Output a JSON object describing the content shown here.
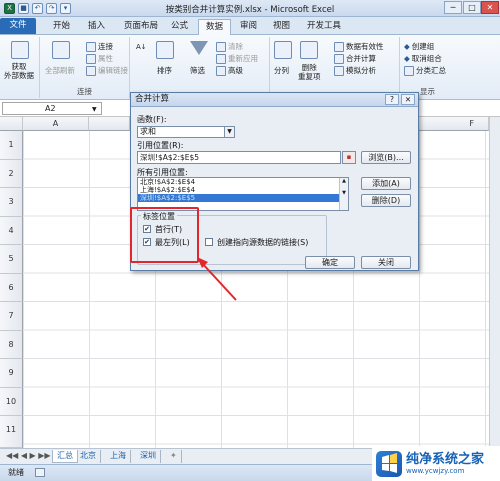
{
  "window": {
    "title": "按类别合并计算实例.xlsx - Microsoft Excel",
    "minimize": "─",
    "maximize": "□",
    "close": "✕"
  },
  "qat": [
    "X",
    "💾",
    "↶",
    "↷",
    "▾"
  ],
  "tabs": [
    "文件",
    "开始",
    "插入",
    "页面布局",
    "公式",
    "数据",
    "审阅",
    "视图",
    "开发工具"
  ],
  "ribbon": {
    "get_external": "获取\n外部数据",
    "refresh_all": "全部刷新",
    "connections": "连接",
    "properties": "属性",
    "edit_links": "编辑链接",
    "group_connections": "连接",
    "sort_az": "A↓Z",
    "sort": "排序",
    "filter": "筛选",
    "clear": "清除",
    "reapply": "重新应用",
    "advanced": "高级",
    "split": "分列",
    "remove_dup": "删除\n重复项",
    "data_validation": "数据有效性",
    "consolidate": "合并计算",
    "what_if": "模拟分析",
    "group": "创建组",
    "ungroup": "取消组合",
    "subtotal": "分类汇总",
    "group_outline": "显示"
  },
  "formula_bar": {
    "name_box": "A2"
  },
  "columns": [
    "A",
    "F"
  ],
  "rows": [
    "1",
    "2",
    "3",
    "4",
    "5",
    "6",
    "7",
    "8",
    "9",
    "10",
    "11"
  ],
  "sheets": [
    "汇总",
    "北京",
    "上海",
    "深圳"
  ],
  "status": {
    "ready": "就绪"
  },
  "dialog": {
    "title": "合并计算",
    "help": "?",
    "close": "✕",
    "function_label": "函数(F):",
    "function_value": "求和",
    "ref_label": "引用位置(R):",
    "ref_value": "深圳!$A$2:$E$5",
    "browse": "浏览(B)...",
    "all_refs_label": "所有引用位置:",
    "all_refs": [
      "北京!$A$2:$E$4",
      "上海!$A$2:$E$4",
      "深圳!$A$2:$E$5"
    ],
    "add": "添加(A)",
    "delete": "删除(D)",
    "labels_group": "标签位置",
    "top_row": "首行(T)",
    "left_col": "最左列(L)",
    "create_links": "创建指向源数据的链接(S)",
    "ok": "确定",
    "cancel": "关闭",
    "top_row_checked": true,
    "left_col_checked": true,
    "create_links_checked": false
  },
  "watermark": {
    "main": "纯净系统之家",
    "sub": "www.ycwjzy.com"
  },
  "colors": {
    "annotation_red": "#e3262b",
    "file_tab": "#2a6bb8",
    "selection": "#3379d4"
  }
}
